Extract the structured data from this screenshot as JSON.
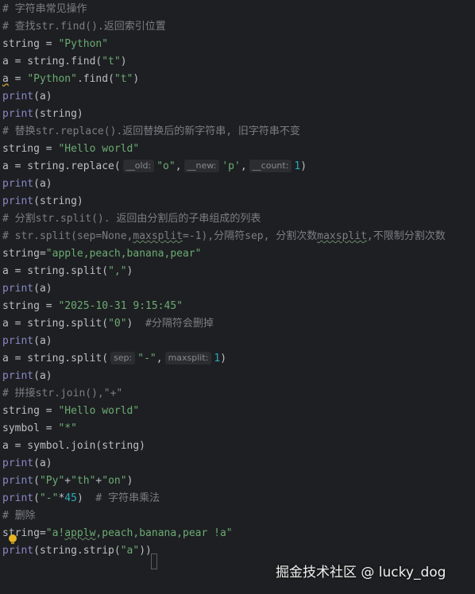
{
  "colors": {
    "background": "#1e1f22",
    "comment": "#7a7e85",
    "string": "#6aab73",
    "builtin": "#8888c6",
    "number": "#2aacb8",
    "text": "#bcbec4",
    "hint_bg": "#2b2d30",
    "hint_text": "#868a91"
  },
  "editor": {
    "lines": [
      [
        {
          "t": "c",
          "v": "# 字符串常见操作"
        }
      ],
      [
        {
          "t": "c",
          "v": "# 查找str.find().返回索引位置"
        }
      ],
      [
        {
          "t": "t",
          "v": "string = "
        },
        {
          "t": "s",
          "v": "\"Python\""
        }
      ],
      [
        {
          "t": "t",
          "v": "a = string.find("
        },
        {
          "t": "s",
          "v": "\"t\""
        },
        {
          "t": "t",
          "v": ")"
        }
      ],
      [
        {
          "t": "t",
          "v": "a",
          "warn": true
        },
        {
          "t": "t",
          "v": " = "
        },
        {
          "t": "s",
          "v": "\"Python\""
        },
        {
          "t": "t",
          "v": ".find("
        },
        {
          "t": "s",
          "v": "\"t\""
        },
        {
          "t": "t",
          "v": ")"
        }
      ],
      [
        {
          "t": "b",
          "v": "print"
        },
        {
          "t": "t",
          "v": "(a)"
        }
      ],
      [
        {
          "t": "b",
          "v": "print"
        },
        {
          "t": "t",
          "v": "(string)"
        }
      ],
      [
        {
          "t": "c",
          "v": "# 替换str.replace().返回替换后的新字符串, 旧字符串不变"
        }
      ],
      [
        {
          "t": "t",
          "v": "string = "
        },
        {
          "t": "s",
          "v": "\"Hello world\""
        }
      ],
      [
        {
          "t": "t",
          "v": "a = string.replace("
        },
        {
          "t": "h",
          "v": "__old:"
        },
        {
          "t": "s",
          "v": "\"o\""
        },
        {
          "t": "t",
          "v": ","
        },
        {
          "t": "h",
          "v": "__new:"
        },
        {
          "t": "s",
          "v": "'p'"
        },
        {
          "t": "t",
          "v": ","
        },
        {
          "t": "h",
          "v": "__count:"
        },
        {
          "t": "n",
          "v": "1"
        },
        {
          "t": "t",
          "v": ")"
        }
      ],
      [
        {
          "t": "b",
          "v": "print"
        },
        {
          "t": "t",
          "v": "(a)"
        }
      ],
      [
        {
          "t": "b",
          "v": "print"
        },
        {
          "t": "t",
          "v": "(string)"
        }
      ],
      [
        {
          "t": "c",
          "v": "# 分割str.split(). 返回由分割后的子串组成的列表"
        }
      ],
      [
        {
          "t": "c",
          "v": "# str.split(sep=None,"
        },
        {
          "t": "c",
          "v": "maxsplit",
          "typo": true
        },
        {
          "t": "c",
          "v": "=-1),分隔符sep, 分割次数"
        },
        {
          "t": "c",
          "v": "maxsplit",
          "typo": true
        },
        {
          "t": "c",
          "v": ",不限制分割次数"
        }
      ],
      [
        {
          "t": "t",
          "v": "string="
        },
        {
          "t": "s",
          "v": "\"apple,peach,banana,pear\""
        }
      ],
      [
        {
          "t": "t",
          "v": "a = string.split("
        },
        {
          "t": "s",
          "v": "\",\""
        },
        {
          "t": "t",
          "v": ")"
        }
      ],
      [
        {
          "t": "b",
          "v": "print"
        },
        {
          "t": "t",
          "v": "(a)"
        }
      ],
      [
        {
          "t": "t",
          "v": "string = "
        },
        {
          "t": "s",
          "v": "\"2025-10-31 9:15:45\""
        }
      ],
      [
        {
          "t": "t",
          "v": "a = string.split("
        },
        {
          "t": "s",
          "v": "\"0\""
        },
        {
          "t": "t",
          "v": ")  "
        },
        {
          "t": "c",
          "v": "#分隔符会删掉"
        }
      ],
      [
        {
          "t": "b",
          "v": "print"
        },
        {
          "t": "t",
          "v": "(a)"
        }
      ],
      [
        {
          "t": "t",
          "v": "a = string.split("
        },
        {
          "t": "h",
          "v": "sep:"
        },
        {
          "t": "s",
          "v": "\"-\""
        },
        {
          "t": "t",
          "v": ","
        },
        {
          "t": "h",
          "v": "maxsplit:"
        },
        {
          "t": "n",
          "v": "1"
        },
        {
          "t": "t",
          "v": ")"
        }
      ],
      [
        {
          "t": "b",
          "v": "print"
        },
        {
          "t": "t",
          "v": "(a)"
        }
      ],
      [
        {
          "t": "c",
          "v": "# 拼接str.join(),\"+\""
        }
      ],
      [
        {
          "t": "t",
          "v": "string = "
        },
        {
          "t": "s",
          "v": "\"Hello world\""
        }
      ],
      [
        {
          "t": "t",
          "v": "symbol = "
        },
        {
          "t": "s",
          "v": "\"*\""
        }
      ],
      [
        {
          "t": "t",
          "v": "a = symbol.join(string)"
        }
      ],
      [
        {
          "t": "b",
          "v": "print"
        },
        {
          "t": "t",
          "v": "(a)"
        }
      ],
      [
        {
          "t": "b",
          "v": "print"
        },
        {
          "t": "t",
          "v": "("
        },
        {
          "t": "s",
          "v": "\"Py\""
        },
        {
          "t": "t",
          "v": "+"
        },
        {
          "t": "s",
          "v": "\"th\""
        },
        {
          "t": "t",
          "v": "+"
        },
        {
          "t": "s",
          "v": "\"on\""
        },
        {
          "t": "t",
          "v": ")"
        }
      ],
      [
        {
          "t": "b",
          "v": "print"
        },
        {
          "t": "t",
          "v": "("
        },
        {
          "t": "s",
          "v": "\"-\""
        },
        {
          "t": "t",
          "v": "*"
        },
        {
          "t": "n",
          "v": "45"
        },
        {
          "t": "t",
          "v": ")  "
        },
        {
          "t": "c",
          "v": "# 字符串乘法"
        }
      ],
      [
        {
          "t": "c",
          "v": "# 删除"
        }
      ],
      [
        {
          "t": "t",
          "v": "string="
        },
        {
          "t": "s",
          "v": "\"a!"
        },
        {
          "t": "s",
          "v": "applw",
          "typo": true
        },
        {
          "t": "s",
          "v": ",peach,banana,pear !a\""
        }
      ],
      [
        {
          "t": "b",
          "v": "print"
        },
        {
          "t": "t",
          "v": "(string.strip("
        },
        {
          "t": "s",
          "v": "\"a\""
        },
        {
          "t": "t",
          "v": "))"
        }
      ]
    ]
  },
  "watermark": {
    "text": "掘金技术社区 @ lucky_dog"
  }
}
